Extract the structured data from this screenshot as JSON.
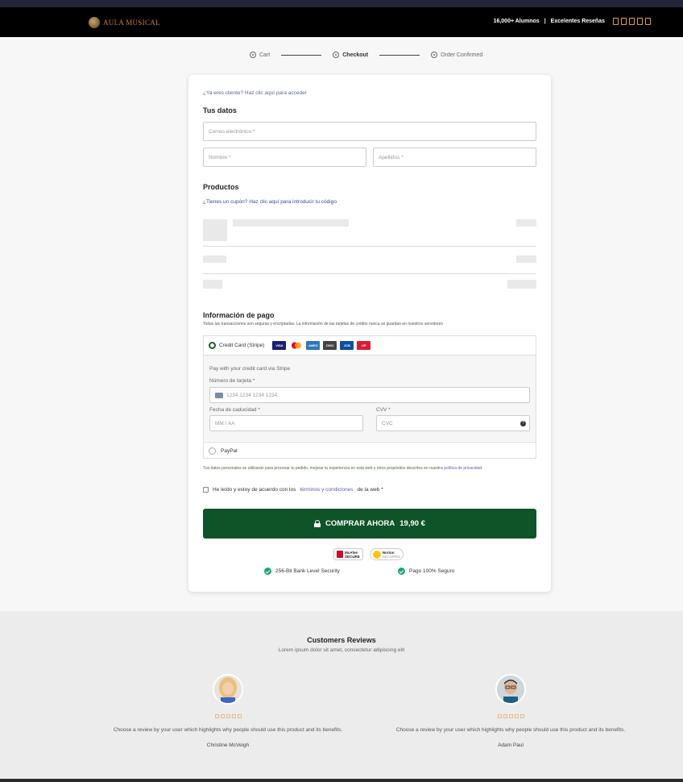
{
  "header": {
    "logo_text": "AULA MUSICAL",
    "tagline_left": "16,000+ Alumnos",
    "separator": "|",
    "tagline_right": "Excelentes Reseñas"
  },
  "steps": [
    {
      "label": "Cart"
    },
    {
      "label": "Checkout"
    },
    {
      "label": "Order Confirmed"
    }
  ],
  "form": {
    "login_prompt": "¿Ya eres cliente? Haz clic aquí para acceder",
    "tus_datos_title": "Tus datos",
    "email_placeholder": "Correo electrónico *",
    "nombre_placeholder": "Nombre *",
    "apellidos_placeholder": "Apellidos *",
    "productos_title": "Productos",
    "coupon_link": "¿Tienes un cupón? Haz clic aquí para introducir tu código",
    "pago_title": "Información de pago",
    "pago_subtitle": "Todas las transacciones son seguras y encriptadas. La información de las tarjetas de crédito nunca se guardan en nuestros servidores",
    "credit_card_label": "Credit Card (Stripe)",
    "stripe_desc": "Pay with your credit card via Stripe",
    "card_number_label": "Número de tarjeta *",
    "card_number_placeholder": "1234 1234 1234 1234",
    "expiry_label": "Fecha de caducidad *",
    "expiry_placeholder": "MM / AA",
    "cvv_label": "CVV *",
    "cvv_placeholder": "CVC",
    "paypal_label": "PayPal",
    "privacy_text": "Tus datos personales se utilizarán para procesar tu pedido, mejorar tu experiencia en esta web y otros propósitos descritos en nuestra",
    "privacy_link": "política de privacidad",
    "terms_prefix": "He leído y estoy de acuerdo con los",
    "terms_link": "términos y condiciones",
    "terms_suffix": "de la web",
    "terms_required": "*",
    "buy_label": "COMPRAR AHORA",
    "buy_price": "19,90 €",
    "badge_mcafee_1": "McAfee",
    "badge_mcafee_2": "SECURE",
    "badge_norton_1": "Norton",
    "badge_norton_2": "SECURED",
    "security_1": "256-Bit Bank Level Security",
    "security_2": "Pago 100% Seguro"
  },
  "card_brands": [
    "VISA",
    "MC",
    "AMEX",
    "DISC",
    "JCB",
    "UP"
  ],
  "reviews": {
    "title": "Customers Reviews",
    "subtitle": "Lorem ipsum dolor sit amet, consectetur adipiscing elit",
    "items": [
      {
        "text": "Choose a review by your user which highlights why people should use this product and its benefits.",
        "name": "Christine McVeigh"
      },
      {
        "text": "Choose a review by your user which highlights why people should use this product and its benefits.",
        "name": "Adam Paul"
      }
    ]
  },
  "colors": {
    "accent_green": "#0f5428",
    "link_blue": "#5a5fa8",
    "star_orange": "#e8a13a",
    "check_teal": "#1aa37a"
  }
}
